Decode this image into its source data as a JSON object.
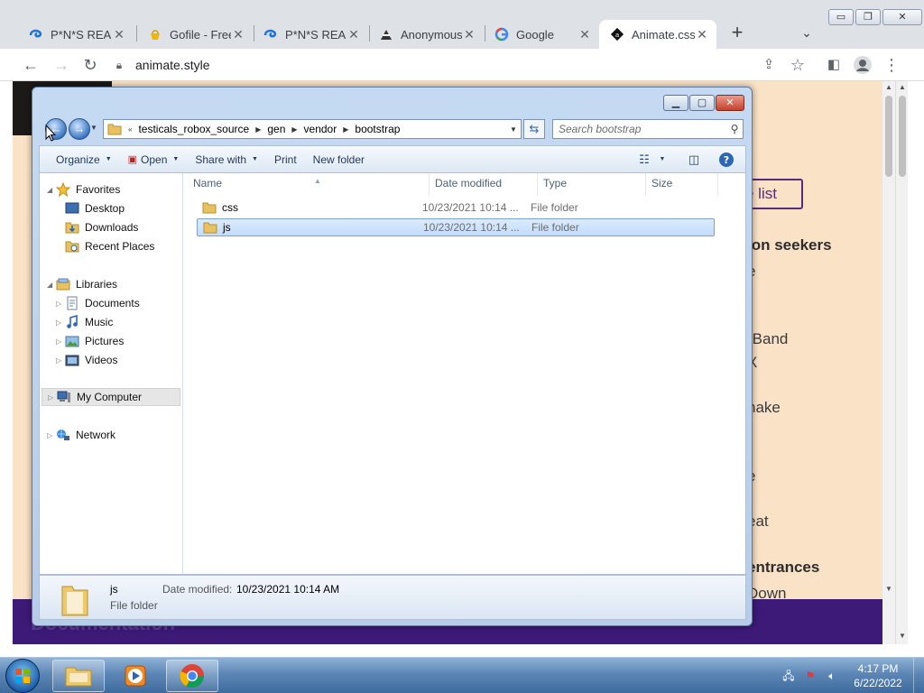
{
  "browser": {
    "tabs": [
      {
        "title": "P*N*S REAL",
        "icon": "blue-swirl-icon"
      },
      {
        "title": "Gofile - Free",
        "icon": "gofile-icon"
      },
      {
        "title": "P*N*S REAL",
        "icon": "blue-swirl-icon"
      },
      {
        "title": "Anonymous",
        "icon": "anonymous-icon"
      },
      {
        "title": "Google",
        "icon": "google-icon"
      },
      {
        "title": "Animate.css",
        "icon": "animate-icon",
        "active": true
      }
    ],
    "url": "animate.style"
  },
  "webpage": {
    "button_text": "e list",
    "lines": [
      {
        "text": "ion seekers",
        "bold": true
      },
      {
        "text": "e"
      },
      {
        "text": "rBand"
      },
      {
        "text": "X"
      },
      {
        "text": "hake"
      },
      {
        "text": "e"
      },
      {
        "text": "eat"
      },
      {
        "text": "entrances",
        "bold": true
      },
      {
        "text": "Down"
      }
    ],
    "banner_text": "Documentation",
    "colors": {
      "background": "#fae2c6",
      "banner": "#3d1a78",
      "accent": "#5a2a7a"
    }
  },
  "explorer": {
    "breadcrumb_prefix": "«",
    "breadcrumbs": [
      "testicals_robox_source",
      "gen",
      "vendor",
      "bootstrap"
    ],
    "search_placeholder": "Search bootstrap",
    "commands": {
      "organize": "Organize",
      "open": "Open",
      "share_with": "Share with",
      "print": "Print",
      "new_folder": "New folder"
    },
    "nav": {
      "favorites": "Favorites",
      "desktop": "Desktop",
      "downloads": "Downloads",
      "recent_places": "Recent Places",
      "libraries": "Libraries",
      "documents": "Documents",
      "music": "Music",
      "pictures": "Pictures",
      "videos": "Videos",
      "my_computer": "My Computer",
      "network": "Network"
    },
    "columns": {
      "name": "Name",
      "date": "Date modified",
      "type": "Type",
      "size": "Size"
    },
    "files": [
      {
        "name": "css",
        "date": "10/23/2021 10:14 ...",
        "type": "File folder",
        "selected": false
      },
      {
        "name": "js",
        "date": "10/23/2021 10:14 ...",
        "type": "File folder",
        "selected": true
      }
    ],
    "details": {
      "name": "js",
      "type": "File folder",
      "date_label": "Date modified:",
      "date_value": "10/23/2021 10:14 AM"
    }
  },
  "taskbar": {
    "apps": [
      "windows-explorer-icon",
      "media-player-icon",
      "chrome-icon"
    ],
    "time": "4:17 PM",
    "date": "6/22/2022"
  }
}
